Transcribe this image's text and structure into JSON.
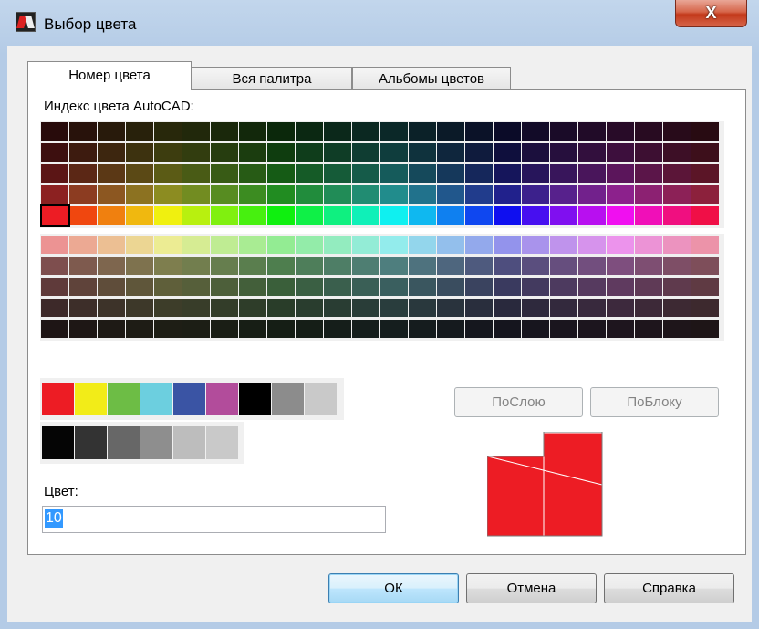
{
  "window": {
    "title": "Выбор цвета",
    "close_label": "X"
  },
  "tabs": [
    {
      "label": "Номер цвета",
      "active": true
    },
    {
      "label": "Вся палитра",
      "active": false
    },
    {
      "label": "Альбомы цветов",
      "active": false
    }
  ],
  "index_label": "Индекс цвета AutoCAD:",
  "selected_color_index": 10,
  "buttons": {
    "bylayer": "ПоСлою",
    "byblock": "ПоБлоку",
    "ok": "ОК",
    "cancel": "Отмена",
    "help": "Справка"
  },
  "color_field": {
    "label": "Цвет:",
    "value": "10"
  },
  "colors": {
    "selected": "#ed1c24",
    "standard": [
      "#ed1c24",
      "#f2ec18",
      "#6dbd45",
      "#6ccfdf",
      "#3a54a4",
      "#b24c9b",
      "#000000",
      "#8c8c8c",
      "#c9c9c9"
    ],
    "grays": [
      "#050505",
      "#333333",
      "#676767",
      "#8e8e8e",
      "#bdbdbd",
      "#c9c9c9"
    ]
  }
}
